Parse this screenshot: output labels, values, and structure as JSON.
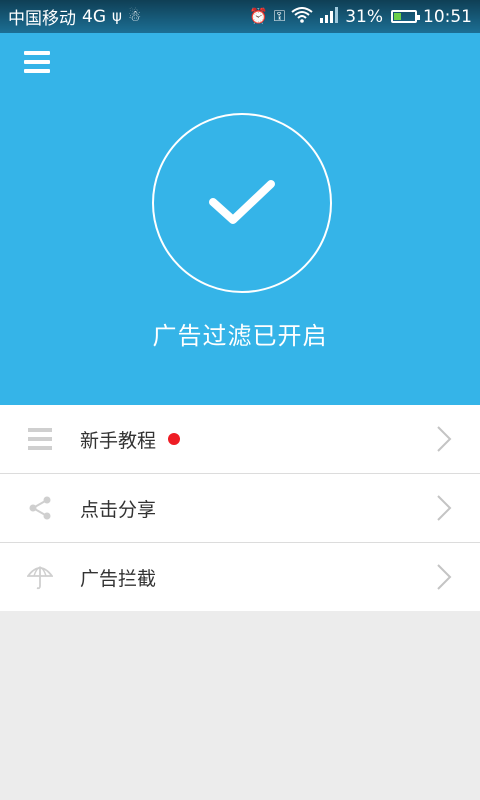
{
  "status_bar": {
    "carrier": "中国移动",
    "network": "4G",
    "battery": "31%",
    "battery_level": 0.31,
    "time": "10:51",
    "icons": [
      "usb-icon",
      "android-icon",
      "alarm-icon",
      "key-icon",
      "wifi-icon",
      "signal-icon",
      "battery-icon"
    ]
  },
  "hero": {
    "status_text": "广告过滤已开启",
    "background": "#35b4e8"
  },
  "menu_items": [
    {
      "label": "新手教程",
      "icon": "list-icon",
      "badge": true
    },
    {
      "label": "点击分享",
      "icon": "share-icon",
      "badge": false
    },
    {
      "label": "广告拦截",
      "icon": "umbrella-icon",
      "badge": false
    }
  ],
  "colors": {
    "accent": "#35b4e8",
    "badge": "#ee1c24",
    "background": "#ececec"
  }
}
